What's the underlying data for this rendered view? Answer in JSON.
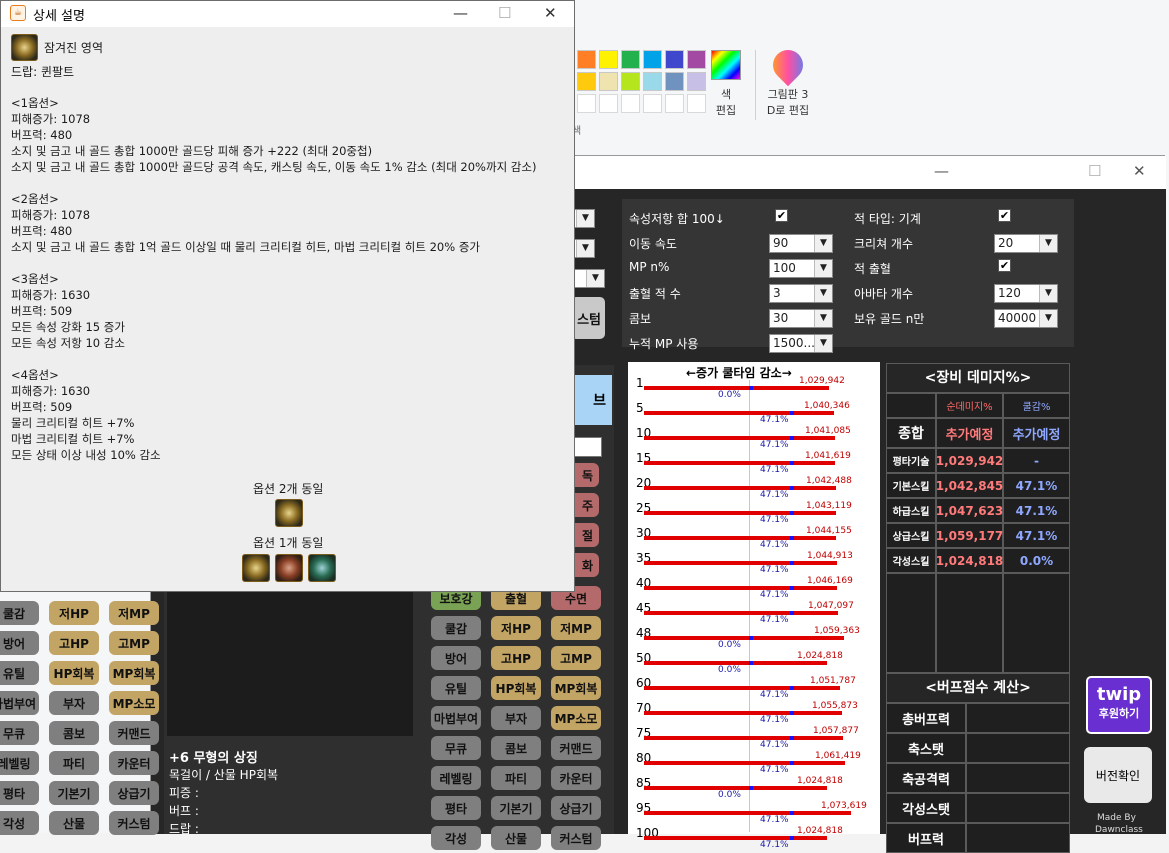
{
  "paint": {
    "edit_colors_label_1": "색",
    "edit_colors_label_2": "편집",
    "paint3d_label_1": "그림판 3",
    "paint3d_label_2": "D로 편집",
    "colors_group_label": "색",
    "palette_row1": [
      "#ff7f27",
      "#fff200",
      "#22b14c",
      "#00a2e8",
      "#3f48cc",
      "#a349a4"
    ],
    "palette_row2": [
      "#ffc90e",
      "#efe4b0",
      "#b5e61d",
      "#99d9ea",
      "#7092be",
      "#c8bfe7"
    ]
  },
  "detail": {
    "window_title": "상세 설명",
    "item_name": "잠겨진 영역",
    "drop": "드랍: 퀸팔트",
    "lines": [
      "<1옵션>",
      "피해증가: 1078",
      "버프력: 480",
      "소지 및 금고 내 골드 총합 1000만 골드당 피해 증가 +222 (최대 20중첩)",
      "소지 및 금고 내 골드 총합 1000만 골드당 공격 속도, 캐스팅 속도, 이동 속도 1% 감소 (최대 20%까지 감소)",
      "",
      "<2옵션>",
      "피해증가: 1078",
      "버프력: 480",
      "소지 및 금고 내 골드 총합 1억 골드 이상일 때 물리 크리티컬 히트, 마법 크리티컬 히트 20% 증가",
      "",
      "<3옵션>",
      "피해증가: 1630",
      "버프력: 509",
      "모든 속성 강화 15 증가",
      "모든 속성 저항 10 감소",
      "",
      "<4옵션>",
      "피해증가: 1630",
      "버프력: 509",
      "물리 크리티컬 히트 +7%",
      "마법 크리티컬 히트 +7%",
      "모든 상태 이상 내성 10% 감소"
    ],
    "same2_label": "옵션 2개 동일",
    "same1_label": "옵션 1개 동일"
  },
  "calc": {
    "options_left": [
      {
        "label": "속성저항 합 100↓",
        "type": "check",
        "checked": "✔"
      },
      {
        "label": "이동 속도",
        "type": "combo",
        "value": "90"
      },
      {
        "label": "MP n%",
        "type": "combo",
        "value": "100"
      },
      {
        "label": "출혈 적 수",
        "type": "combo",
        "value": "3"
      },
      {
        "label": "콤보",
        "type": "combo",
        "value": "30"
      },
      {
        "label": "누적 MP 사용",
        "type": "combo",
        "value": "1500..."
      }
    ],
    "options_right": [
      {
        "label": "적 타입: 기계",
        "type": "check",
        "checked": "✔"
      },
      {
        "label": "크리쳐 개수",
        "type": "combo",
        "value": "20"
      },
      {
        "label": "적 출혈",
        "type": "check",
        "checked": "✔"
      },
      {
        "label": "아바타 개수",
        "type": "combo",
        "value": "120"
      },
      {
        "label": "보유 골드 n만",
        "type": "combo",
        "value": "40000"
      }
    ],
    "partial_button": "스텀",
    "partial_button2": "브",
    "chart_header": "←증가  쿨타임  감소→",
    "equip_header": "<장비 데미지%>",
    "equip_col1": "순데미지%",
    "equip_col2": "쿨감%",
    "equip_rows": [
      {
        "name": "종합",
        "dmg": "추가예정",
        "cd": "추가예정"
      },
      {
        "name": "평타기술",
        "dmg": "1,029,942",
        "cd": "-"
      },
      {
        "name": "기본스킬",
        "dmg": "1,042,845",
        "cd": "47.1%"
      },
      {
        "name": "하급스킬",
        "dmg": "1,047,623",
        "cd": "47.1%"
      },
      {
        "name": "상급스킬",
        "dmg": "1,059,177",
        "cd": "47.1%"
      },
      {
        "name": "각성스킬",
        "dmg": "1,024,818",
        "cd": "0.0%"
      }
    ],
    "buff_header": "<버프점수 계산>",
    "buff_rows": [
      "총버프력",
      "축스탯",
      "축공격력",
      "각성스탯",
      "버프력"
    ],
    "twip_top": "twip",
    "twip_bottom": "후원하기",
    "version_button": "버전확인",
    "made_by_1": "Made By",
    "made_by_2": "Dawnclass",
    "item_title": "+6 무형의 상징",
    "item_lines": [
      "목걸이 / 산물 HP회복",
      "피증 :",
      "버프 :",
      "드랍 :"
    ],
    "pills_left": [
      [
        "쿨감",
        "저HP",
        "저MP"
      ],
      [
        "방어",
        "고HP",
        "고MP"
      ],
      [
        "유틸",
        "HP회복",
        "MP회복"
      ],
      [
        "마법부여",
        "부자",
        "MP소모"
      ],
      [
        "무큐",
        "콤보",
        "커맨드"
      ],
      [
        "레벨링",
        "파티",
        "카운터"
      ],
      [
        "평타",
        "기본기",
        "상급기"
      ],
      [
        "각성",
        "산물",
        "커스텀"
      ]
    ],
    "pills_mid": [
      [
        "보호강",
        "출혈",
        "수면"
      ],
      [
        "쿨감",
        "저HP",
        "저MP"
      ],
      [
        "방어",
        "고HP",
        "고MP"
      ],
      [
        "유틸",
        "HP회복",
        "MP회복"
      ],
      [
        "마법부여",
        "부자",
        "MP소모"
      ],
      [
        "무큐",
        "콤보",
        "커맨드"
      ],
      [
        "레벨링",
        "파티",
        "카운터"
      ],
      [
        "평타",
        "기본기",
        "상급기"
      ],
      [
        "각성",
        "산물",
        "커스텀"
      ]
    ],
    "pills_mid_partial": [
      "독",
      "주",
      "절",
      "화"
    ]
  },
  "chart_data": {
    "type": "bar",
    "title": "←증가  쿨타임  감소→",
    "categories": [
      "1",
      "5",
      "10",
      "15",
      "20",
      "25",
      "30",
      "35",
      "40",
      "45",
      "48",
      "50",
      "60",
      "70",
      "75",
      "80",
      "85",
      "95",
      "100"
    ],
    "series": [
      {
        "values": [
          1029942,
          1040346,
          1041085,
          1041619,
          1042488,
          1043119,
          1044155,
          1044913,
          1046169,
          1047097,
          1059363,
          1024818,
          1051787,
          1055873,
          1057877,
          1061419,
          1024818,
          1073619,
          1024818
        ]
      },
      {
        "values": [
          0.0,
          47.1,
          47.1,
          47.1,
          47.1,
          47.1,
          47.1,
          47.1,
          47.1,
          47.1,
          0.0,
          0.0,
          47.1,
          47.1,
          47.1,
          47.1,
          0.0,
          47.1,
          47.1
        ]
      }
    ],
    "value_labels": [
      "1,029,942",
      "1,040,346",
      "1,041,085",
      "1,041,619",
      "1,042,488",
      "1,043,119",
      "1,044,155",
      "1,044,913",
      "1,046,169",
      "1,047,097",
      "1,059,363",
      "1,024,818",
      "1,051,787",
      "1,055,873",
      "1,057,877",
      "1,061,419",
      "1,024,818",
      "1,073,619",
      "1,024,818"
    ],
    "cooldown_labels": [
      "0.0%",
      "47.1%",
      "47.1%",
      "47.1%",
      "47.1%",
      "47.1%",
      "47.1%",
      "47.1%",
      "47.1%",
      "47.1%",
      "0.0%",
      "0.0%",
      "47.1%",
      "47.1%",
      "47.1%",
      "47.1%",
      "0.0%",
      "47.1%",
      "47.1%"
    ],
    "colors": {
      "damage": "#e00000",
      "cooldown": "#1414ff"
    }
  }
}
